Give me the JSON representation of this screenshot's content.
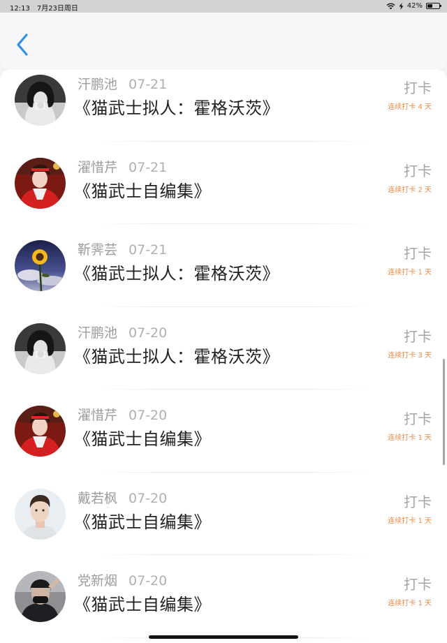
{
  "status_bar": {
    "time": "12:13",
    "date": "7月23日周日",
    "battery": "42%",
    "battery_level": 0.42,
    "icons": [
      "wifi-icon",
      "charging-icon",
      "battery-icon"
    ]
  },
  "nav": {
    "back_icon": "chevron-left-icon",
    "accent_color": "#2f8ff0"
  },
  "list": [
    {
      "name": "汗鹏池",
      "date": "07-21",
      "title": "《猫武士拟人：霍格沃茨》",
      "action": "打卡",
      "streak": "连续打卡 4 天",
      "avatar": "avatar-girl-bw"
    },
    {
      "name": "濯惜芹",
      "date": "07-21",
      "title": "《猫武士自编集》",
      "action": "打卡",
      "streak": "连续打卡 2 天",
      "avatar": "avatar-girl-red"
    },
    {
      "name": "靳霁芸",
      "date": "07-21",
      "title": "《猫武士拟人：霍格沃茨》",
      "action": "打卡",
      "streak": "连续打卡 1 天",
      "avatar": "avatar-sunflower"
    },
    {
      "name": "汗鹏池",
      "date": "07-20",
      "title": "《猫武士拟人：霍格沃茨》",
      "action": "打卡",
      "streak": "连续打卡 3 天",
      "avatar": "avatar-girl-bw"
    },
    {
      "name": "濯惜芹",
      "date": "07-20",
      "title": "《猫武士自编集》",
      "action": "打卡",
      "streak": "连续打卡 1 天",
      "avatar": "avatar-girl-red"
    },
    {
      "name": "戴若枫",
      "date": "07-20",
      "title": "《猫武士自编集》",
      "action": "打卡",
      "streak": "连续打卡 1 天",
      "avatar": "avatar-man"
    },
    {
      "name": "党新烟",
      "date": "07-20",
      "title": "《猫武士自编集》",
      "action": "打卡",
      "streak": "连续打卡 1 天",
      "avatar": "avatar-masked"
    }
  ],
  "colors": {
    "streak": "#ea8a45",
    "name": "#9c9ca0",
    "title": "#222222",
    "checkin": "#a5a5a9"
  }
}
